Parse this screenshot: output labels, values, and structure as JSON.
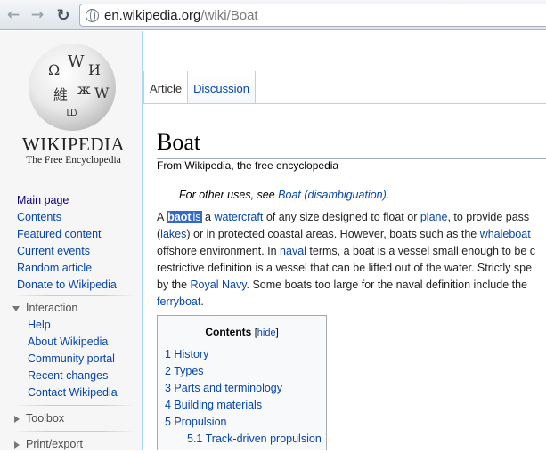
{
  "browser": {
    "url_host": "en.wikipedia.org",
    "url_path": "/wiki/Boat"
  },
  "sidebar": {
    "logo": {
      "wordmark": "WIKIPEDIA",
      "tagline": "The Free Encyclopedia"
    },
    "nav": [
      "Main page",
      "Contents",
      "Featured content",
      "Current events",
      "Random article",
      "Donate to Wikipedia"
    ],
    "interaction": {
      "heading": "Interaction",
      "items": [
        "Help",
        "About Wikipedia",
        "Community portal",
        "Recent changes",
        "Contact Wikipedia"
      ]
    },
    "toolbox": {
      "heading": "Toolbox"
    },
    "printexport": {
      "heading": "Print/export"
    }
  },
  "tabs": [
    "Article",
    "Discussion"
  ],
  "article": {
    "title": "Boat",
    "from": "From Wikipedia, the free encyclopedia",
    "hatnote": {
      "prefix": "For other uses, see ",
      "link": "Boat (disambiguation)",
      "suffix": "."
    },
    "lines": {
      "l1_a": "A ",
      "l1_hl": "baot",
      "l1_hl2": "is",
      "l1_b": " a ",
      "l1_link1": "watercraft",
      "l1_c": " of any size designed to float or ",
      "l1_link2": "plane",
      "l1_d": ", to provide pass",
      "l2_a": "(",
      "l2_link1": "lakes",
      "l2_b": ") or in protected coastal areas. However, boats such as the ",
      "l2_link2": "whaleboat",
      "l3_a": "offshore environment. In ",
      "l3_link1": "naval",
      "l3_b": " terms, a boat is a vessel small enough to be c",
      "l4": "restrictive definition is a vessel that can be lifted out of the water. Strictly spe",
      "l5_a": "by the ",
      "l5_link1": "Royal Navy",
      "l5_b": ". Some boats too large for the naval definition include the",
      "l6_link1": "ferryboat",
      "l6_b": "."
    }
  },
  "toc": {
    "heading": "Contents",
    "hide_open": "[",
    "hide_label": "hide",
    "hide_close": "]",
    "items": [
      "1 History",
      "2 Types",
      "3 Parts and terminology",
      "4 Building materials",
      "5 Propulsion"
    ],
    "sub_items": [
      "5.1 Track-driven propulsion"
    ]
  }
}
